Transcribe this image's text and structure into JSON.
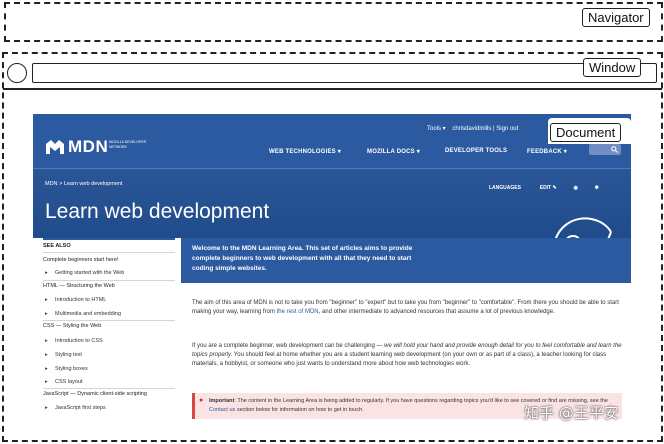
{
  "labels": {
    "navigator": "Navigator",
    "window": "Window",
    "document": "Document"
  },
  "mdn": {
    "top_links": [
      "Tools ▾",
      "chrisdavidmills",
      "Sign out"
    ],
    "logo_text": "MDN",
    "logo_sub": "MOZILLA DEVELOPER NETWORK",
    "nav": [
      "WEB TECHNOLOGIES ▾",
      "MOZILLA DOCS ▾",
      "DEVELOPER TOOLS",
      "FEEDBACK ▾"
    ],
    "breadcrumb": [
      "MDN",
      "Learn web development"
    ],
    "actions": [
      "LANGUAGES",
      "EDIT"
    ],
    "page_title": "Learn web development",
    "see_also": "SEE ALSO",
    "sidebar": [
      {
        "text": "Complete beginners start here!",
        "sub": false
      },
      {
        "text": "Getting started with the Web",
        "sub": true
      },
      {
        "text": "HTML — Structuring the Web",
        "sub": false
      },
      {
        "text": "Introduction to HTML",
        "sub": true
      },
      {
        "text": "Multimedia and embedding",
        "sub": true
      },
      {
        "text": "CSS — Styling the Web",
        "sub": false
      },
      {
        "text": "Introduction to CSS",
        "sub": true
      },
      {
        "text": "Styling text",
        "sub": true
      },
      {
        "text": "Styling boxes",
        "sub": true
      },
      {
        "text": "CSS layout",
        "sub": true
      },
      {
        "text": "JavaScript — Dynamic client-side scripting",
        "sub": false
      },
      {
        "text": "JavaScript first steps",
        "sub": true
      }
    ],
    "intro": "Welcome to the MDN Learning Area. This set of articles aims to provide complete beginners to web development with all that they need to start coding simple websites.",
    "para1_a": "The aim of this area of MDN is not to take you from \"beginner\" to \"expert\" but to take you from \"beginner\" to \"comfortable\". From there you should be able to start making your way, learning from ",
    "para1_link": "the rest of MDN",
    "para1_b": ", and other intermediate to advanced resources that assume a lot of previous knowledge.",
    "para2_a": "If you are a complete beginner, web development can be challenging — ",
    "para2_em": "we will hold your hand and provide enough detail for you to feel comfortable and learn the topics properly.",
    "para2_b": " You should feel at home whether you are a student learning web development (on your own or as part of a class), a teacher looking for class materials, a hobbyist, or someone who just wants to understand more about how web technologies work.",
    "note_label": "Important",
    "note_text": ": The content in the Learning Area is being added to regularly. If you have questions regarding topics you'd like to see covered or find are missing, see the ",
    "note_link": "Contact us",
    "note_tail": " section below for information on how to get in touch."
  },
  "watermark": "知乎 @王平安",
  "colors": {
    "mdn_blue": "#2c5aa0",
    "mdn_dark": "#1e4a87",
    "note_bg": "#fbe3e3"
  }
}
